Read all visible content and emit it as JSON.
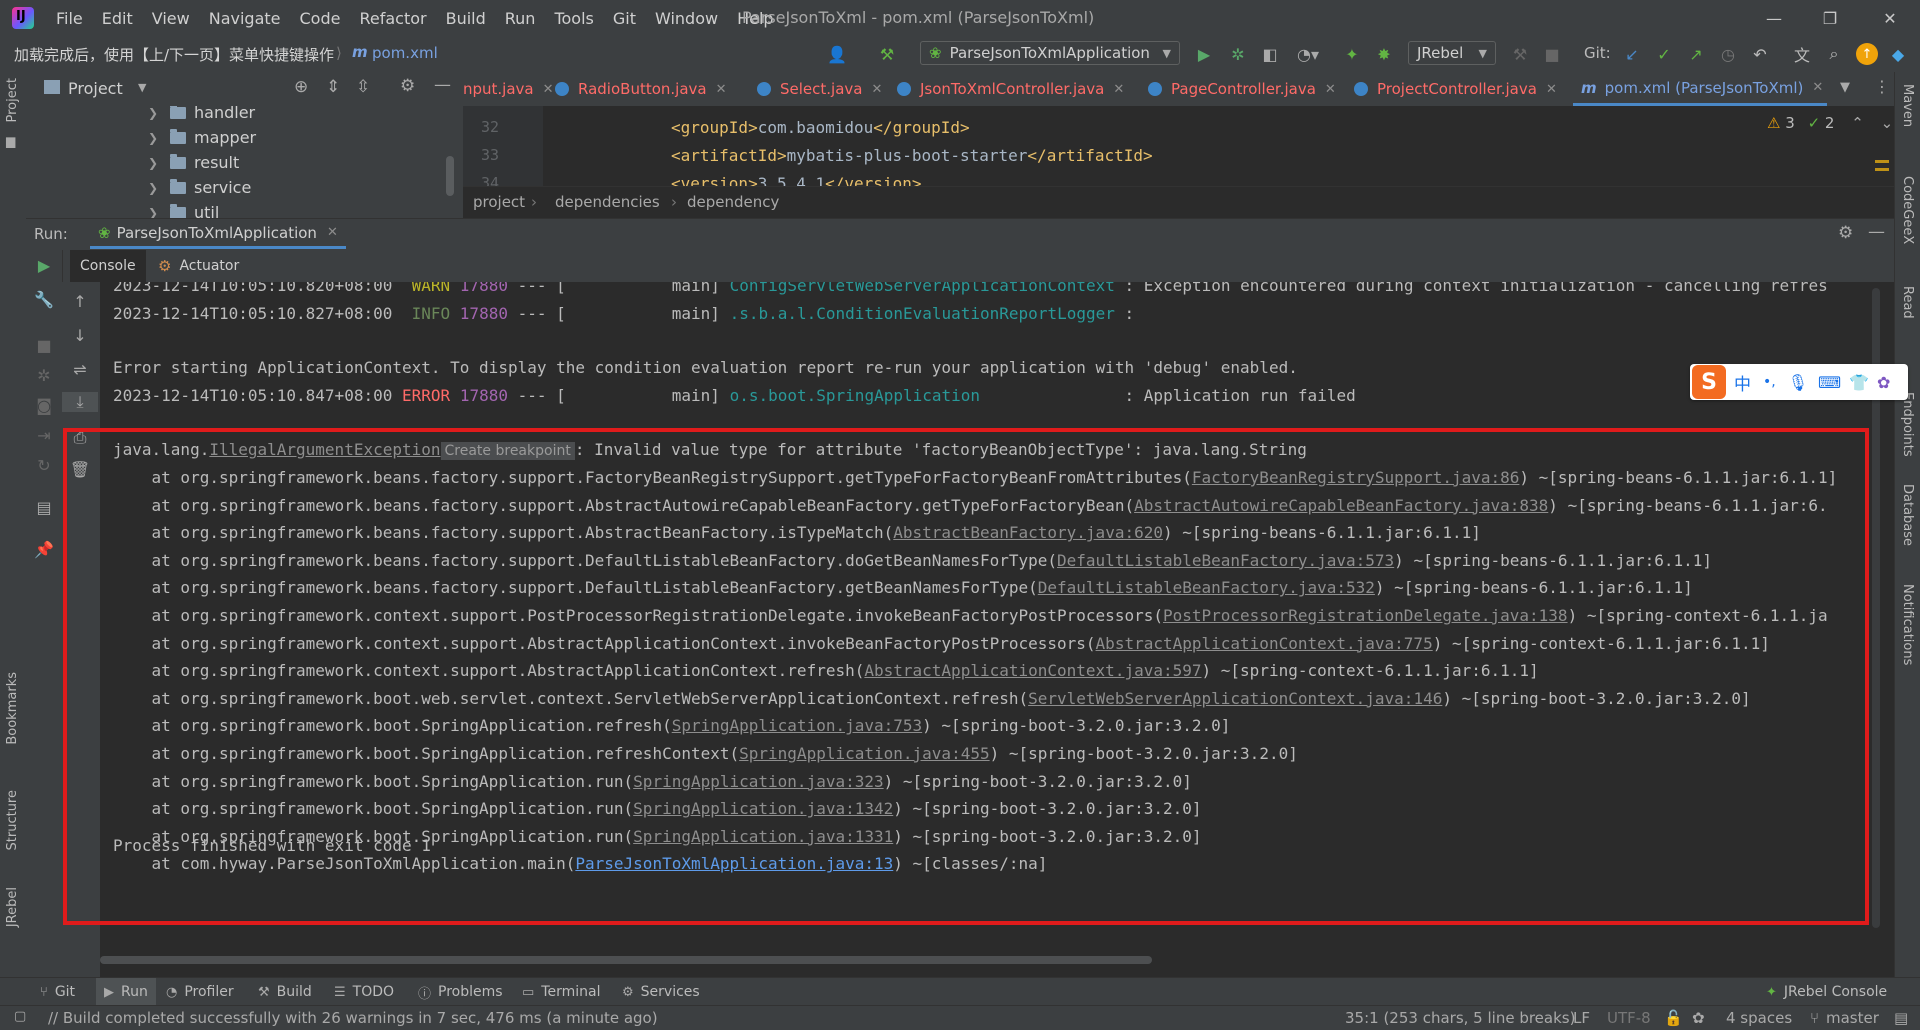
{
  "titlebar": {
    "menu": [
      "File",
      "Edit",
      "View",
      "Navigate",
      "Code",
      "Refactor",
      "Build",
      "Run",
      "Tools",
      "Git",
      "Window",
      "Help"
    ],
    "title": "ParseJsonToXml - pom.xml (ParseJsonToXml)"
  },
  "toolbar": {
    "status_message": "加载完成后，使用【上/下一页】菜单快捷键操作",
    "file_crumb": "pom.xml",
    "run_config": "ParseJsonToXmlApplication",
    "jrebel_label": "JRebel",
    "git_label": "Git:"
  },
  "project_panel": {
    "title": "Project",
    "tree": [
      "handler",
      "mapper",
      "result",
      "service",
      "util"
    ]
  },
  "left_strip": {
    "project": "Project",
    "bookmarks": "Bookmarks",
    "structure": "Structure",
    "jrebel": "JRebel"
  },
  "right_strip": {
    "maven": "Maven",
    "codegeex": "CodeGeeX",
    "read": "Read",
    "endpoints": "Endpoints",
    "database": "Database",
    "notifications": "Notifications"
  },
  "tabs": [
    {
      "label": "nput.java",
      "color": "#ff6b68"
    },
    {
      "label": "RadioButton.java",
      "color": "#ff6b68"
    },
    {
      "label": "Select.java",
      "color": "#ff6b68"
    },
    {
      "label": "JsonToXmlController.java",
      "color": "#ff6b68"
    },
    {
      "label": "PageController.java",
      "color": "#ff6b68"
    },
    {
      "label": "ProjectController.java",
      "color": "#ff6b68"
    },
    {
      "label": "pom.xml (ParseJsonToXml)",
      "color": "#79a1e0"
    }
  ],
  "editor": {
    "inspections": {
      "warnings": "3",
      "ok": "2"
    },
    "lines": [
      {
        "num": "32",
        "open": "<groupId>",
        "text": "com.baomidou",
        "close": "</groupId>"
      },
      {
        "num": "33",
        "open": "<artifactId>",
        "text": "mybatis-plus-boot-starter",
        "close": "</artifactId>"
      },
      {
        "num": "34",
        "open": "<version>",
        "text": "3.5.4.1",
        "close": "</version>"
      }
    ],
    "breadcrumb": [
      "project",
      "dependencies",
      "dependency"
    ]
  },
  "run_panel": {
    "label": "Run:",
    "config_tab": "ParseJsonToXmlApplication",
    "subtabs": [
      "Console",
      "Actuator"
    ]
  },
  "console": {
    "line1": {
      "ts": "2023-12-14T10:05:10.820+08:00",
      "level": "WARN",
      "pid": "17880",
      "sep": "--- [",
      "thread": "main]",
      "logger": "ConfigServletWebServerApplicationContext",
      "msg": ": Exception encountered during context initialization - cancelling refres"
    },
    "line2": {
      "ts": "2023-12-14T10:05:10.827+08:00",
      "level": "INFO",
      "pid": "17880",
      "sep": "--- [",
      "thread": "main]",
      "logger": ".s.b.a.l.ConditionEvaluationReportLogger",
      "msg": ":"
    },
    "error_start": "Error starting ApplicationContext. To display the condition evaluation report re-run your application with 'debug' enabled.",
    "line4": {
      "ts": "2023-12-14T10:05:10.847+08:00",
      "level": "ERROR",
      "pid": "17880",
      "sep": "--- [",
      "thread": "main]",
      "logger": "o.s.boot.SpringApplication",
      "msg": ": Application run failed"
    },
    "exception": {
      "prefix": "java.lang.",
      "class": "IllegalArgumentException",
      "breakpoint": "Create breakpoint",
      "message": ": Invalid value type for attribute 'factoryBeanObjectType': java.lang.String"
    },
    "stack": [
      {
        "pre": "    at org.springframework.beans.factory.support.FactoryBeanRegistrySupport.getTypeForFactoryBeanFromAttributes(",
        "link": "FactoryBeanRegistrySupport.java:86",
        "post": ") ~[spring-beans-6.1.1.jar:6.1.1]"
      },
      {
        "pre": "    at org.springframework.beans.factory.support.AbstractAutowireCapableBeanFactory.getTypeForFactoryBean(",
        "link": "AbstractAutowireCapableBeanFactory.java:838",
        "post": ") ~[spring-beans-6.1.1.jar:6."
      },
      {
        "pre": "    at org.springframework.beans.factory.support.AbstractBeanFactory.isTypeMatch(",
        "link": "AbstractBeanFactory.java:620",
        "post": ") ~[spring-beans-6.1.1.jar:6.1.1]"
      },
      {
        "pre": "    at org.springframework.beans.factory.support.DefaultListableBeanFactory.doGetBeanNamesForType(",
        "link": "DefaultListableBeanFactory.java:573",
        "post": ") ~[spring-beans-6.1.1.jar:6.1.1]"
      },
      {
        "pre": "    at org.springframework.beans.factory.support.DefaultListableBeanFactory.getBeanNamesForType(",
        "link": "DefaultListableBeanFactory.java:532",
        "post": ") ~[spring-beans-6.1.1.jar:6.1.1]"
      },
      {
        "pre": "    at org.springframework.context.support.PostProcessorRegistrationDelegate.invokeBeanFactoryPostProcessors(",
        "link": "PostProcessorRegistrationDelegate.java:138",
        "post": ") ~[spring-context-6.1.1.ja"
      },
      {
        "pre": "    at org.springframework.context.support.AbstractApplicationContext.invokeBeanFactoryPostProcessors(",
        "link": "AbstractApplicationContext.java:775",
        "post": ") ~[spring-context-6.1.1.jar:6.1.1]"
      },
      {
        "pre": "    at org.springframework.context.support.AbstractApplicationContext.refresh(",
        "link": "AbstractApplicationContext.java:597",
        "post": ") ~[spring-context-6.1.1.jar:6.1.1]"
      },
      {
        "pre": "    at org.springframework.boot.web.servlet.context.ServletWebServerApplicationContext.refresh(",
        "link": "ServletWebServerApplicationContext.java:146",
        "post": ") ~[spring-boot-3.2.0.jar:3.2.0]"
      },
      {
        "pre": "    at org.springframework.boot.SpringApplication.refresh(",
        "link": "SpringApplication.java:753",
        "post": ") ~[spring-boot-3.2.0.jar:3.2.0]"
      },
      {
        "pre": "    at org.springframework.boot.SpringApplication.refreshContext(",
        "link": "SpringApplication.java:455",
        "post": ") ~[spring-boot-3.2.0.jar:3.2.0]"
      },
      {
        "pre": "    at org.springframework.boot.SpringApplication.run(",
        "link": "SpringApplication.java:323",
        "post": ") ~[spring-boot-3.2.0.jar:3.2.0]"
      },
      {
        "pre": "    at org.springframework.boot.SpringApplication.run(",
        "link": "SpringApplication.java:1342",
        "post": ") ~[spring-boot-3.2.0.jar:3.2.0]"
      },
      {
        "pre": "    at org.springframework.boot.SpringApplication.run(",
        "link": "SpringApplication.java:1331",
        "post": ") ~[spring-boot-3.2.0.jar:3.2.0]"
      },
      {
        "pre": "    at com.hyway.ParseJsonToXmlApplication.main(",
        "link": "ParseJsonToXmlApplication.java:13",
        "post": ") ~[classes/:na]",
        "primary": true
      }
    ],
    "exit_line": "Process finished with exit code 1"
  },
  "ime": {
    "lang": "中",
    "punct": "•,"
  },
  "bottom_tabs": [
    "Git",
    "Run",
    "Profiler",
    "Build",
    "TODO",
    "Problems",
    "Terminal",
    "Services"
  ],
  "jrebel_console": "JRebel Console",
  "status": {
    "build_msg": "// Build completed successfully with 26 warnings in 7 sec, 476 ms (a minute ago)",
    "position": "35:1 (253 chars, 5 line breaks)",
    "line_sep": "LF",
    "encoding": "UTF-8",
    "indent": "4 spaces",
    "branch": "master"
  },
  "colors": {
    "highlight_box": "#e01b1b",
    "accent": "#4a88c7"
  }
}
